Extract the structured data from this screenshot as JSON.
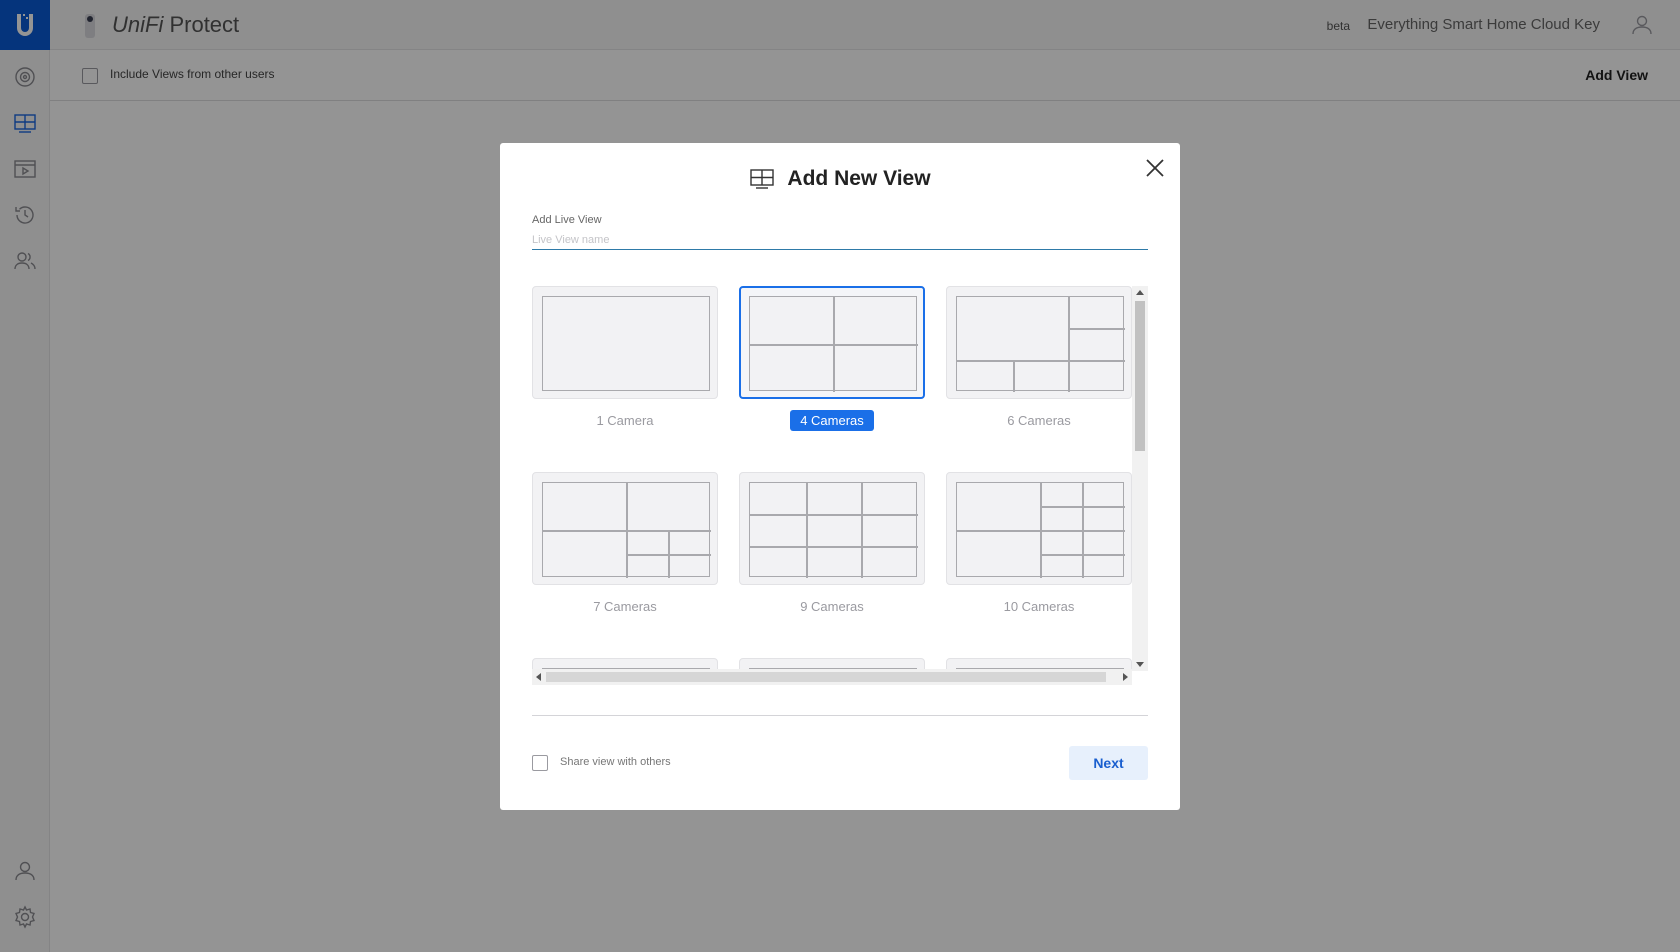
{
  "app": {
    "brand_prefix": "UniFi",
    "brand_suffix": " Protect",
    "beta": "beta",
    "console_name": "Everything Smart Home Cloud Key"
  },
  "rail": {
    "items": [
      {
        "icon": "camera-icon"
      },
      {
        "icon": "liveview-grid-icon",
        "active": true
      },
      {
        "icon": "video-play-icon"
      },
      {
        "icon": "history-icon"
      },
      {
        "icon": "users-icon"
      }
    ],
    "bottom": [
      {
        "icon": "user-icon"
      },
      {
        "icon": "gear-icon"
      }
    ]
  },
  "subbar": {
    "include_views_label": "Include Views from other users",
    "add_view_label": "Add View"
  },
  "modal": {
    "title": "Add New View",
    "field_label": "Add Live View",
    "field_placeholder": "Live View name",
    "layouts": [
      {
        "label": "1 Camera",
        "selected": false
      },
      {
        "label": "4 Cameras",
        "selected": true
      },
      {
        "label": "6 Cameras",
        "selected": false
      },
      {
        "label": "7 Cameras",
        "selected": false
      },
      {
        "label": "9 Cameras",
        "selected": false
      },
      {
        "label": "10 Cameras",
        "selected": false
      }
    ],
    "share_label": "Share view with others",
    "next_label": "Next"
  },
  "colors": {
    "accent": "#1a6fe8",
    "logo_bg": "#0a5bd6",
    "next_bg": "#e7f0fc"
  }
}
